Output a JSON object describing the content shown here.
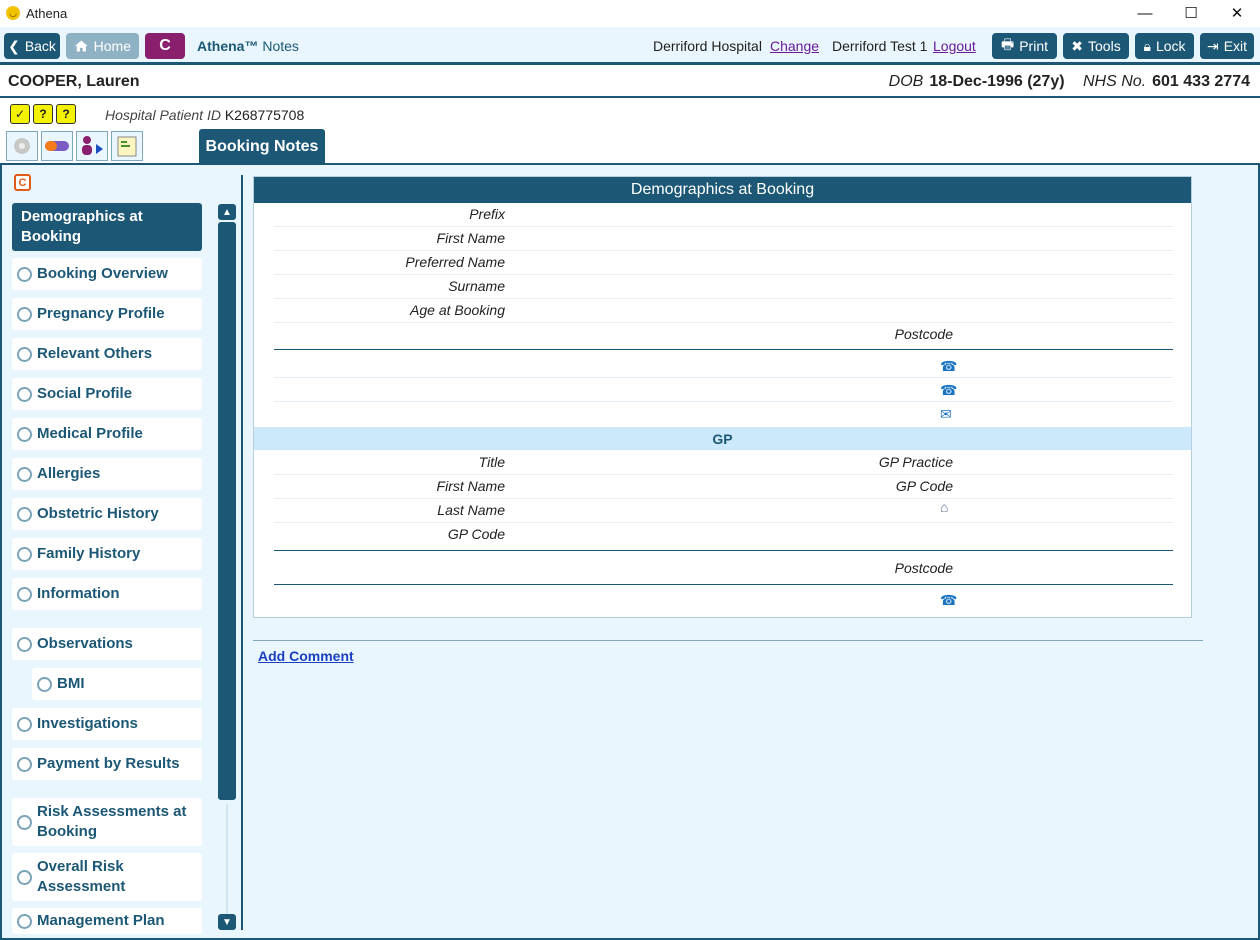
{
  "window": {
    "title": "Athena",
    "controls": {
      "minimize": "—",
      "maximize": "☐",
      "close": "✕"
    }
  },
  "toolbar": {
    "back": "Back",
    "home": "Home",
    "c": "C",
    "brand": "Athena™",
    "brand_sub": "Notes",
    "hospital": "Derriford Hospital",
    "change": "Change",
    "user": "Derriford Test 1",
    "logout": "Logout",
    "print": "Print",
    "tools": "Tools",
    "lock": "Lock",
    "exit": "Exit"
  },
  "patient": {
    "name": "COOPER, Lauren",
    "dob_label": "DOB",
    "dob": "18-Dec-1996 (27y)",
    "nhs_label": "NHS No.",
    "nhs": "601 433 2774",
    "hosp_id_label": "Hospital Patient ID",
    "hosp_id": "K268775708"
  },
  "alerts": [
    "✓",
    "?",
    "?"
  ],
  "tab": {
    "active": "Booking Notes"
  },
  "left_marker": "C",
  "nav": [
    {
      "label": "Demographics at Booking",
      "active": true
    },
    {
      "label": "Booking Overview"
    },
    {
      "label": "Pregnancy Profile"
    },
    {
      "label": "Relevant Others"
    },
    {
      "label": "Social Profile"
    },
    {
      "label": "Medical Profile"
    },
    {
      "label": "Allergies"
    },
    {
      "label": "Obstetric History"
    },
    {
      "label": "Family History"
    },
    {
      "label": "Information"
    },
    {
      "label": "Observations"
    },
    {
      "label": "BMI",
      "sub": true
    },
    {
      "label": "Investigations"
    },
    {
      "label": "Payment by Results"
    },
    {
      "label": "Risk Assessments at Booking"
    },
    {
      "label": "Overall Risk Assessment"
    },
    {
      "label": "Management Plan"
    }
  ],
  "panel": {
    "title": "Demographics at Booking",
    "fields": {
      "prefix": "Prefix",
      "first_name": "First Name",
      "preferred_name": "Preferred Name",
      "surname": "Surname",
      "age": "Age at Booking",
      "postcode": "Postcode"
    },
    "gp": {
      "title": "GP",
      "title_field": "Title",
      "practice": "GP Practice",
      "first_name": "First Name",
      "gp_code_right": "GP Code",
      "last_name": "Last Name",
      "gp_code": "GP Code",
      "postcode": "Postcode"
    }
  },
  "add_comment": "Add Comment"
}
